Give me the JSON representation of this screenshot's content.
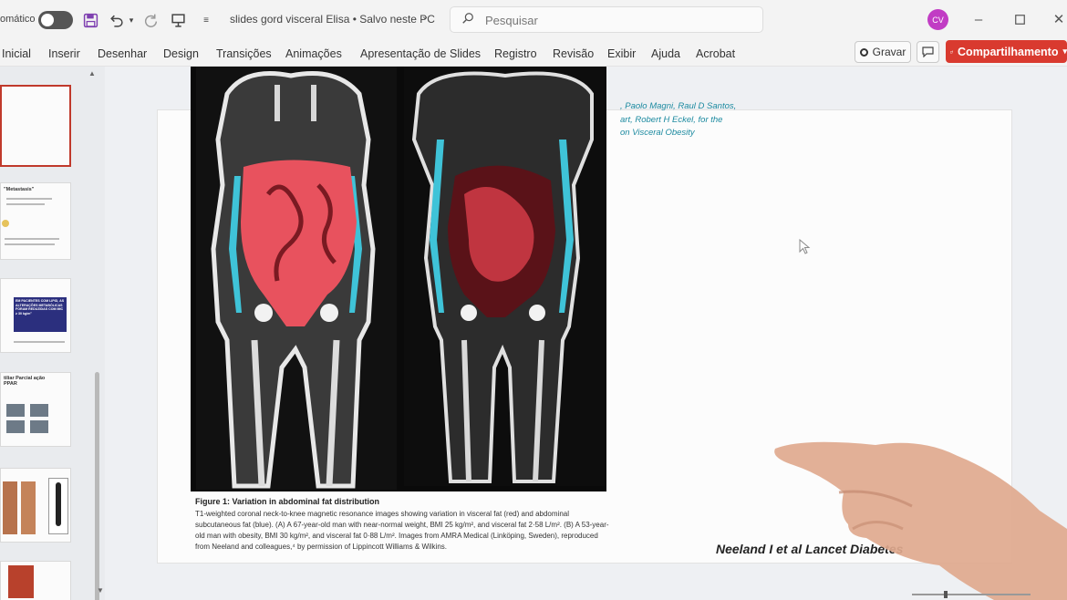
{
  "titlebar": {
    "autosave_label": "omático",
    "doc_title": "slides gord visceral Elisa • Salvo neste PC",
    "search_placeholder": "Pesquisar",
    "avatar_initials": "CV"
  },
  "ribbon": {
    "tabs": [
      "Inicial",
      "Inserir",
      "Desenhar",
      "Design",
      "Transições",
      "Animações",
      "Apresentação de Slides",
      "Registro",
      "Revisão",
      "Exibir",
      "Ajuda",
      "Acrobat"
    ],
    "record_label": "Gravar",
    "share_label": "Compartilhamento"
  },
  "slide_panel": {
    "thumb2_title": "\"Metastasis\"",
    "thumb3_text": "EM PACIENTES COM LIPID, AS ALTERAÇÕES METABÓLICAS FORAM REDUZIDAS COM IMC ≥ 30 kg/m²",
    "thumb4_title": "tiliar Parcial ação PPAR"
  },
  "slide": {
    "authors": [
      ", Paolo Magni, Raul D Santos,",
      "art, Robert H Eckel, for the",
      "on Visceral Obesity"
    ],
    "caption_title": "Figure 1: Variation in abdominal fat distribution",
    "caption_body": "T1-weighted coronal neck-to-knee magnetic resonance images showing variation in visceral fat (red) and abdominal subcutaneous fat (blue). (A) A 67-year-old man with near-normal weight, BMI 25 kg/m², and visceral fat 2·58 L/m². (B) A 53-year-old man with obesity, BMI 30 kg/m², and visceral fat 0·88 L/m². Images from AMRA Medical (Linköping, Sweden), reproduced from Neeland and colleagues,⁴ by permission of Lippincott Williams & Wilkins.",
    "citation": "Neeland I et al Lancet Diabetes"
  },
  "colors": {
    "share_button": "#d93a2f",
    "avatar": "#c13cc4",
    "author_text": "#1c8aa0",
    "visceral_fat": "#e8525e",
    "subcutaneous_fat": "#3fc3d8"
  }
}
